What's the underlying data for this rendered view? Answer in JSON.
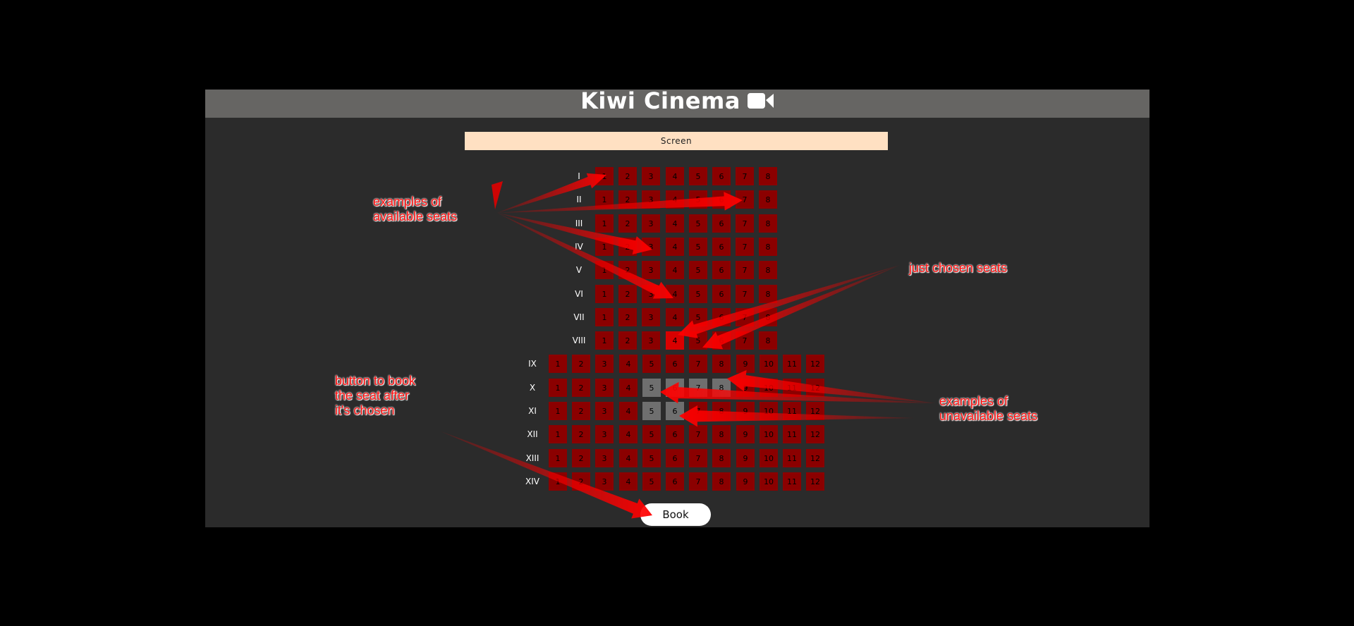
{
  "header": {
    "title": "Kiwi Cinema",
    "icon": "video-camera-icon"
  },
  "screen_label": "Screen",
  "seat_colors": {
    "available": "#8b0000",
    "chosen": "#d90000",
    "unavailable": "#6f6f6f"
  },
  "rows": [
    {
      "label": "I",
      "seats": 8,
      "unavailable": [],
      "chosen": []
    },
    {
      "label": "II",
      "seats": 8,
      "unavailable": [],
      "chosen": []
    },
    {
      "label": "III",
      "seats": 8,
      "unavailable": [],
      "chosen": []
    },
    {
      "label": "IV",
      "seats": 8,
      "unavailable": [],
      "chosen": []
    },
    {
      "label": "V",
      "seats": 8,
      "unavailable": [],
      "chosen": []
    },
    {
      "label": "VI",
      "seats": 8,
      "unavailable": [],
      "chosen": []
    },
    {
      "label": "VII",
      "seats": 8,
      "unavailable": [],
      "chosen": []
    },
    {
      "label": "VIII",
      "seats": 8,
      "unavailable": [],
      "chosen": [
        4
      ]
    },
    {
      "label": "IX",
      "seats": 12,
      "unavailable": [],
      "chosen": []
    },
    {
      "label": "X",
      "seats": 12,
      "unavailable": [
        5,
        6,
        7,
        8
      ],
      "chosen": []
    },
    {
      "label": "XI",
      "seats": 12,
      "unavailable": [
        5,
        6
      ],
      "chosen": []
    },
    {
      "label": "XII",
      "seats": 12,
      "unavailable": [],
      "chosen": []
    },
    {
      "label": "XIII",
      "seats": 12,
      "unavailable": [],
      "chosen": []
    },
    {
      "label": "XIV",
      "seats": 12,
      "unavailable": [],
      "chosen": []
    }
  ],
  "book_button": {
    "label": "Book"
  },
  "annotations": {
    "available": "examples of\navailable seats",
    "chosen": "just chosen seats",
    "book": "button to book\nthe seat after\nit's chosen",
    "unavailable": "examples of\nunavailable seats"
  }
}
